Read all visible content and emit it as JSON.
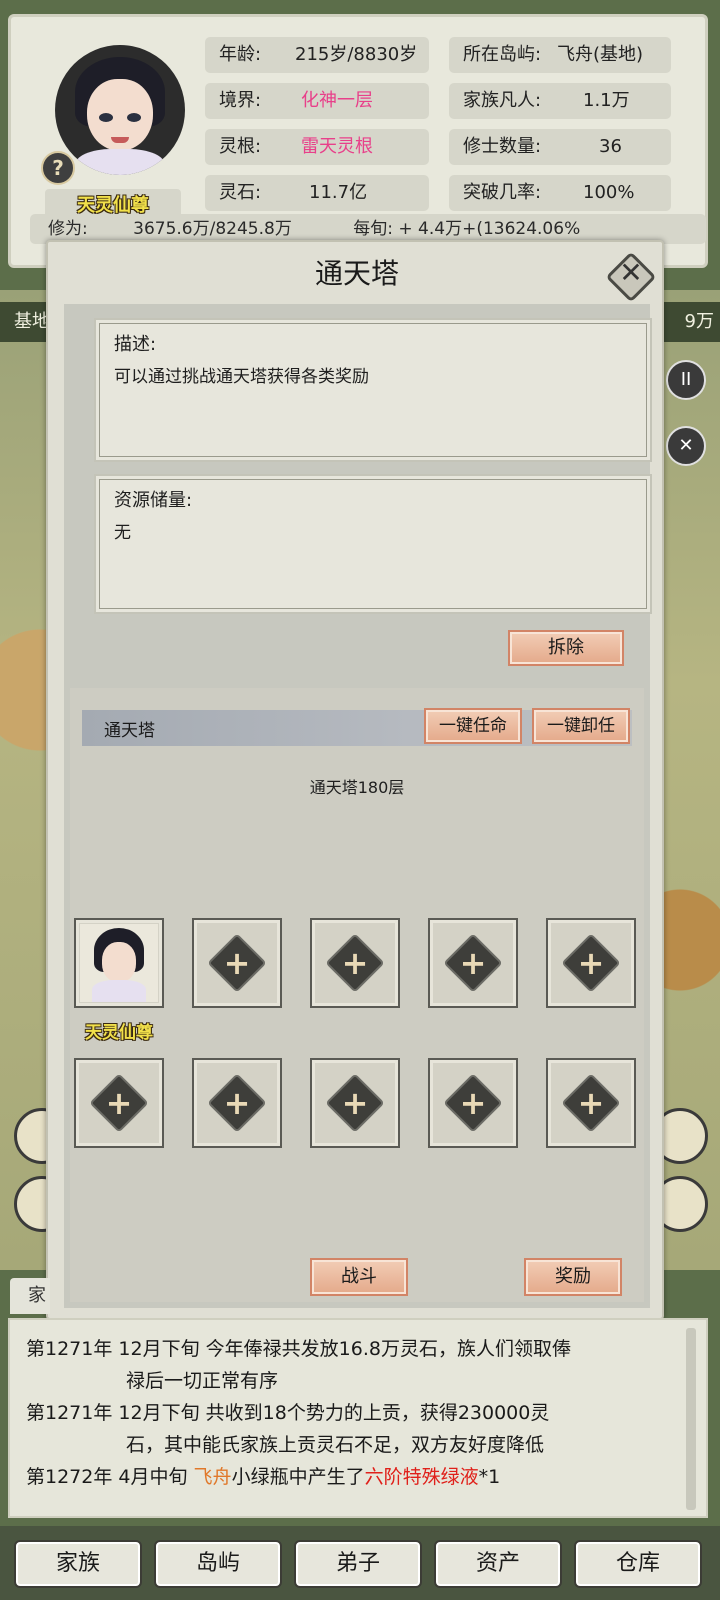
{
  "profile": {
    "name": "天灵仙尊",
    "age_label": "年龄:",
    "age_value": "215岁/8830岁",
    "island_label": "所在岛屿:",
    "island_value": "飞舟(基地)",
    "realm_label": "境界:",
    "realm_value": "化神一层",
    "mortals_label": "家族凡人:",
    "mortals_value": "1.1万",
    "root_label": "灵根:",
    "root_value": "雷天灵根",
    "cultivators_label": "修士数量:",
    "cultivators_value": "36",
    "stones_label": "灵石:",
    "stones_value": "11.7亿",
    "breakthrough_label": "突破几率:",
    "breakthrough_value": "100%",
    "cultivation_label": "修为:",
    "cultivation_value": "3675.6万/8245.8万",
    "per_tick_label": "每旬:",
    "per_tick_value": "+ 4.4万+(13624.06%",
    "help_icon": "?"
  },
  "side": {
    "base_label": "基地",
    "right_value": "9万",
    "pause_icon": "II",
    "close_icon": "✕"
  },
  "modal": {
    "title": "通天塔",
    "close_icon": "✕",
    "description_label": "描述:",
    "description_text": "可以通过挑战通天塔获得各类奖励",
    "resources_label": "资源储量:",
    "resources_text": "无",
    "demolish_button": "拆除",
    "section_title": "通天塔",
    "appoint_all_button": "一键任命",
    "dismiss_all_button": "一键卸任",
    "floor_text": "通天塔180层",
    "slots": [
      {
        "filled": true,
        "name": "天灵仙尊"
      },
      {
        "filled": false
      },
      {
        "filled": false
      },
      {
        "filled": false
      },
      {
        "filled": false
      },
      {
        "filled": false
      },
      {
        "filled": false
      },
      {
        "filled": false
      },
      {
        "filled": false
      },
      {
        "filled": false
      }
    ],
    "plus_symbol": "+",
    "battle_button": "战斗",
    "reward_button": "奖励"
  },
  "log": {
    "tab_label": "家",
    "entries": [
      {
        "prefix": "第1271年",
        "time": "12月下旬",
        "text": "今年俸禄共发放16.8万灵石，族人们领取俸",
        "cont": "禄后一切正常有序"
      },
      {
        "prefix": "第1271年",
        "time": "12月下旬",
        "text": "共收到18个势力的上贡，获得230000灵",
        "cont": "石，其中能氏家族上贡灵石不足，双方友好度降低"
      },
      {
        "prefix": "第1272年",
        "time": "4月中旬",
        "highlight1": "飞舟",
        "mid": "小绿瓶中产生了",
        "highlight2": "六阶特殊绿液",
        "suffix": "*1"
      }
    ]
  },
  "nav": {
    "items": [
      "家族",
      "岛屿",
      "弟子",
      "资产",
      "仓库"
    ]
  },
  "colors": {
    "accent_pink": "#e8408a",
    "name_gold": "#f1e04a",
    "log_orange": "#e0782a",
    "log_red": "#e0201a",
    "button_salmon": "#e4a98a"
  }
}
